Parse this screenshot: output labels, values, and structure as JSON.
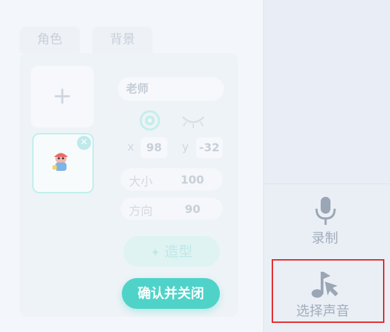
{
  "tabs": {
    "role": "角色",
    "background": "背景"
  },
  "sprite": {
    "name": "老师"
  },
  "position": {
    "x_label": "x",
    "x_value": "98",
    "y_label": "y",
    "y_value": "-32"
  },
  "size": {
    "label": "大小",
    "value": "100"
  },
  "direction": {
    "label": "方向",
    "value": "90"
  },
  "buttons": {
    "shape": "造型",
    "confirm": "确认并关闭"
  },
  "sound_menu": {
    "record_label": "录制",
    "select_label": "选择声音"
  },
  "colors": {
    "accent": "#4fd3c9",
    "highlight": "#e32b2b",
    "icon_gray": "#9aa6b5"
  }
}
